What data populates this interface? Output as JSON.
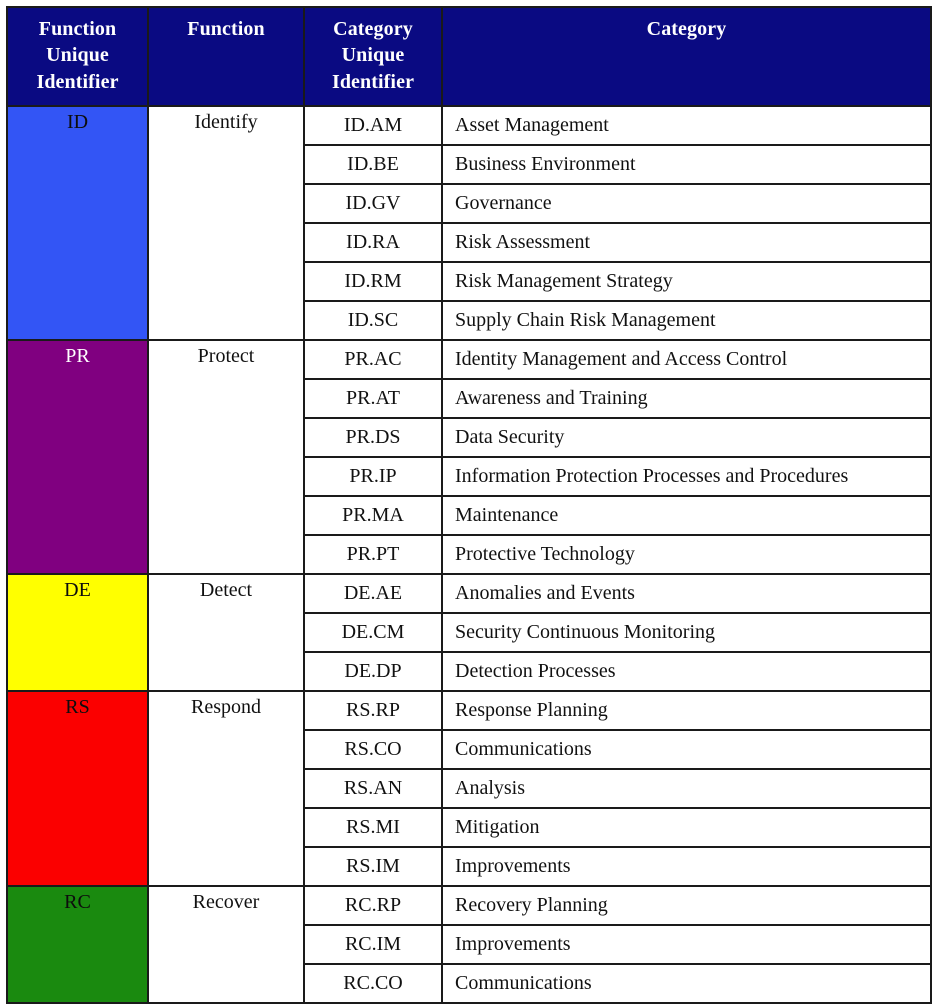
{
  "table": {
    "headers": {
      "function_unique_identifier": "Function\nUnique\nIdentifier",
      "function_unique_identifier_lines": [
        "Function",
        "Unique",
        "Identifier"
      ],
      "function": "Function",
      "category_unique_identifier_lines": [
        "Category",
        "Unique",
        "Identifier"
      ],
      "category": "Category"
    },
    "header_bg": "#0a0a82",
    "header_fg": "#ffffff",
    "border_color": "#1a1a1a",
    "functions": [
      {
        "unique_identifier": "ID",
        "name": "Identify",
        "color": "#3355f5",
        "text_color": "#0d0d0d",
        "categories": [
          {
            "unique_identifier": "ID.AM",
            "name": "Asset Management"
          },
          {
            "unique_identifier": "ID.BE",
            "name": "Business Environment"
          },
          {
            "unique_identifier": "ID.GV",
            "name": "Governance"
          },
          {
            "unique_identifier": "ID.RA",
            "name": "Risk Assessment"
          },
          {
            "unique_identifier": "ID.RM",
            "name": "Risk Management Strategy"
          },
          {
            "unique_identifier": "ID.SC",
            "name": "Supply Chain Risk Management"
          }
        ]
      },
      {
        "unique_identifier": "PR",
        "name": "Protect",
        "color": "#800080",
        "text_color": "#ffffff",
        "categories": [
          {
            "unique_identifier": "PR.AC",
            "name": "Identity Management and Access Control"
          },
          {
            "unique_identifier": "PR.AT",
            "name": "Awareness and Training"
          },
          {
            "unique_identifier": "PR.DS",
            "name": "Data Security"
          },
          {
            "unique_identifier": "PR.IP",
            "name": "Information Protection Processes and Procedures"
          },
          {
            "unique_identifier": "PR.MA",
            "name": "Maintenance"
          },
          {
            "unique_identifier": "PR.PT",
            "name": "Protective Technology"
          }
        ]
      },
      {
        "unique_identifier": "DE",
        "name": "Detect",
        "color": "#ffff00",
        "text_color": "#0d0d0d",
        "categories": [
          {
            "unique_identifier": "DE.AE",
            "name": "Anomalies and Events"
          },
          {
            "unique_identifier": "DE.CM",
            "name": "Security Continuous Monitoring"
          },
          {
            "unique_identifier": "DE.DP",
            "name": "Detection Processes"
          }
        ]
      },
      {
        "unique_identifier": "RS",
        "name": "Respond",
        "color": "#fb0000",
        "text_color": "#0d0d0d",
        "categories": [
          {
            "unique_identifier": "RS.RP",
            "name": "Response Planning"
          },
          {
            "unique_identifier": "RS.CO",
            "name": "Communications"
          },
          {
            "unique_identifier": "RS.AN",
            "name": "Analysis"
          },
          {
            "unique_identifier": "RS.MI",
            "name": "Mitigation"
          },
          {
            "unique_identifier": "RS.IM",
            "name": "Improvements"
          }
        ]
      },
      {
        "unique_identifier": "RC",
        "name": "Recover",
        "color": "#1a8a0f",
        "text_color": "#0d0d0d",
        "categories": [
          {
            "unique_identifier": "RC.RP",
            "name": "Recovery Planning"
          },
          {
            "unique_identifier": "RC.IM",
            "name": "Improvements"
          },
          {
            "unique_identifier": "RC.CO",
            "name": "Communications"
          }
        ]
      }
    ]
  }
}
